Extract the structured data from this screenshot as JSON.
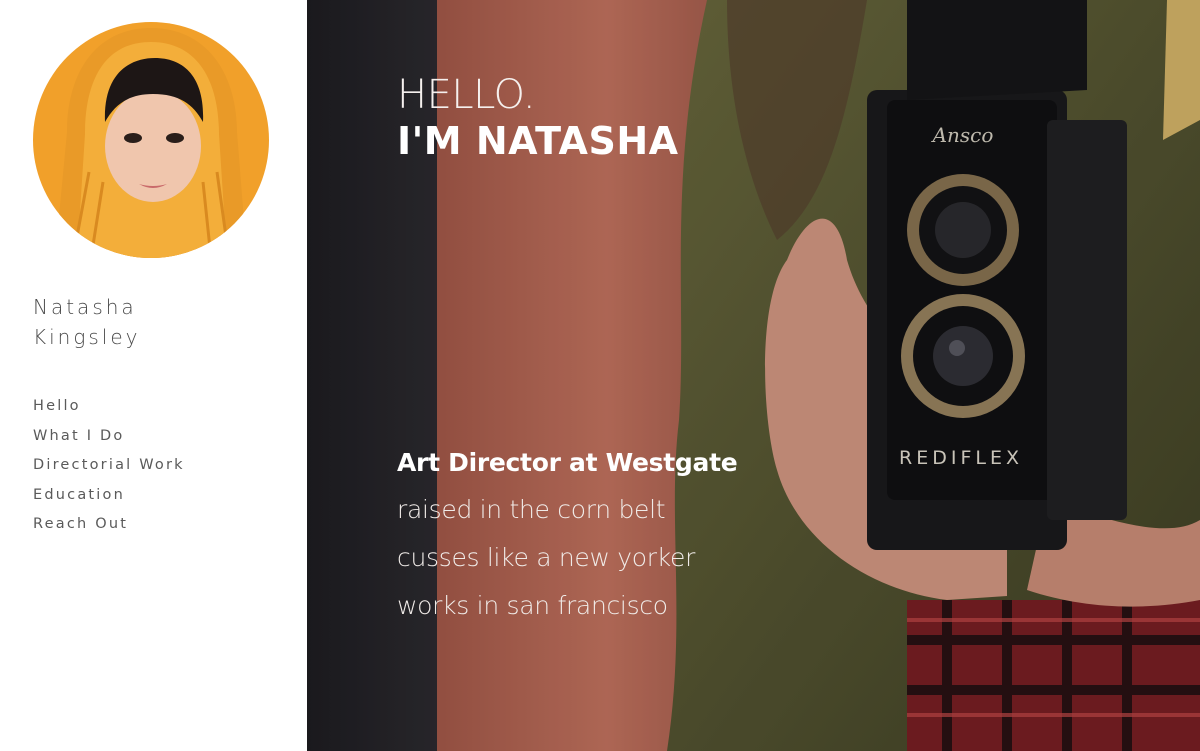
{
  "profile": {
    "first_name": "Natasha",
    "last_name": "Kingsley"
  },
  "nav": {
    "items": [
      {
        "label": "Hello"
      },
      {
        "label": "What I Do"
      },
      {
        "label": "Directorial Work"
      },
      {
        "label": "Education"
      },
      {
        "label": "Reach Out"
      }
    ]
  },
  "hero": {
    "greeting_small": "HELLO.",
    "greeting_big": "I'M NATASHA",
    "role": "Art Director at Westgate",
    "bio_lines": [
      "raised in the corn belt",
      "cusses like a new yorker",
      "works in san francisco"
    ],
    "camera_brand": "Ansco",
    "camera_model": "REDIFLEX"
  },
  "colors": {
    "sidebar_bg": "#ffffff",
    "text_primary": "#4a4a4a",
    "avatar_bg": "#f0a428",
    "hero_text": "#ffffff"
  }
}
